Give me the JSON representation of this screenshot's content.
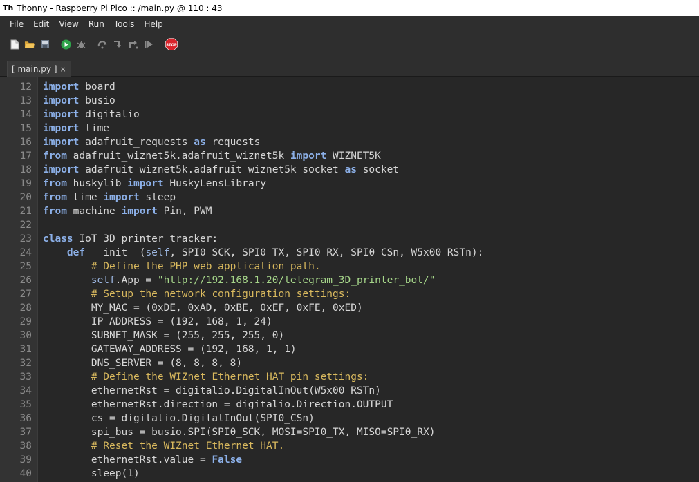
{
  "window": {
    "title": "Thonny  -  Raspberry Pi Pico :: /main.py  @  110 : 43"
  },
  "menu": [
    "File",
    "Edit",
    "View",
    "Run",
    "Tools",
    "Help"
  ],
  "toolbar": {
    "icons": [
      "new-file-icon",
      "open-file-icon",
      "save-icon",
      "run-icon",
      "debug-icon",
      "step-over-icon",
      "step-into-icon",
      "step-out-icon",
      "resume-icon",
      "stop-icon"
    ],
    "stop_label": "STOP"
  },
  "tabs": [
    {
      "label": "[ main.py ]",
      "close": "×"
    }
  ],
  "colors": {
    "keyword": "#8cb0e8",
    "comment": "#d9b95e",
    "string": "#a6d68a",
    "text": "#d6d6d6",
    "line_number": "#8a8a8a",
    "editor_bg": "#272727"
  },
  "editor": {
    "lines": [
      {
        "n": "12",
        "tokens": [
          {
            "t": "kw",
            "v": "import"
          },
          {
            "t": "plain",
            "v": " board"
          }
        ]
      },
      {
        "n": "13",
        "tokens": [
          {
            "t": "kw",
            "v": "import"
          },
          {
            "t": "plain",
            "v": " busio"
          }
        ]
      },
      {
        "n": "14",
        "tokens": [
          {
            "t": "kw",
            "v": "import"
          },
          {
            "t": "plain",
            "v": " digitalio"
          }
        ]
      },
      {
        "n": "15",
        "tokens": [
          {
            "t": "kw",
            "v": "import"
          },
          {
            "t": "plain",
            "v": " time"
          }
        ]
      },
      {
        "n": "16",
        "tokens": [
          {
            "t": "kw",
            "v": "import"
          },
          {
            "t": "plain",
            "v": " adafruit_requests "
          },
          {
            "t": "kw",
            "v": "as"
          },
          {
            "t": "plain",
            "v": " requests"
          }
        ]
      },
      {
        "n": "17",
        "tokens": [
          {
            "t": "kw",
            "v": "from"
          },
          {
            "t": "plain",
            "v": " adafruit_wiznet5k.adafruit_wiznet5k "
          },
          {
            "t": "kw",
            "v": "import"
          },
          {
            "t": "plain",
            "v": " WIZNET5K"
          }
        ]
      },
      {
        "n": "18",
        "tokens": [
          {
            "t": "kw",
            "v": "import"
          },
          {
            "t": "plain",
            "v": " adafruit_wiznet5k.adafruit_wiznet5k_socket "
          },
          {
            "t": "kw",
            "v": "as"
          },
          {
            "t": "plain",
            "v": " socket"
          }
        ]
      },
      {
        "n": "19",
        "tokens": [
          {
            "t": "kw",
            "v": "from"
          },
          {
            "t": "plain",
            "v": " huskylib "
          },
          {
            "t": "kw",
            "v": "import"
          },
          {
            "t": "plain",
            "v": " HuskyLensLibrary"
          }
        ]
      },
      {
        "n": "20",
        "tokens": [
          {
            "t": "kw",
            "v": "from"
          },
          {
            "t": "plain",
            "v": " time "
          },
          {
            "t": "kw",
            "v": "import"
          },
          {
            "t": "plain",
            "v": " sleep"
          }
        ]
      },
      {
        "n": "21",
        "tokens": [
          {
            "t": "kw",
            "v": "from"
          },
          {
            "t": "plain",
            "v": " machine "
          },
          {
            "t": "kw",
            "v": "import"
          },
          {
            "t": "plain",
            "v": " Pin, PWM"
          }
        ]
      },
      {
        "n": "22",
        "tokens": []
      },
      {
        "n": "23",
        "tokens": [
          {
            "t": "kw",
            "v": "class"
          },
          {
            "t": "plain",
            "v": " IoT_3D_printer_tracker:"
          }
        ]
      },
      {
        "n": "24",
        "tokens": [
          {
            "t": "plain",
            "v": "    "
          },
          {
            "t": "kw",
            "v": "def"
          },
          {
            "t": "plain",
            "v": " __init__("
          },
          {
            "t": "self",
            "v": "self"
          },
          {
            "t": "plain",
            "v": ", SPI0_SCK, SPI0_TX, SPI0_RX, SPI0_CSn, W5x00_RSTn):"
          }
        ]
      },
      {
        "n": "25",
        "tokens": [
          {
            "t": "plain",
            "v": "        "
          },
          {
            "t": "cmt",
            "v": "# Define the PHP web application path."
          }
        ]
      },
      {
        "n": "26",
        "tokens": [
          {
            "t": "plain",
            "v": "        "
          },
          {
            "t": "self",
            "v": "self"
          },
          {
            "t": "plain",
            "v": ".App = "
          },
          {
            "t": "str",
            "v": "\"http://192.168.1.20/telegram_3D_printer_bot/\""
          }
        ]
      },
      {
        "n": "27",
        "tokens": [
          {
            "t": "plain",
            "v": "        "
          },
          {
            "t": "cmt",
            "v": "# Setup the network configuration settings:"
          }
        ]
      },
      {
        "n": "28",
        "tokens": [
          {
            "t": "plain",
            "v": "        MY_MAC = (0xDE, 0xAD, 0xBE, 0xEF, 0xFE, 0xED)"
          }
        ]
      },
      {
        "n": "29",
        "tokens": [
          {
            "t": "plain",
            "v": "        IP_ADDRESS = (192, 168, 1, 24)"
          }
        ]
      },
      {
        "n": "30",
        "tokens": [
          {
            "t": "plain",
            "v": "        SUBNET_MASK = (255, 255, 255, 0)"
          }
        ]
      },
      {
        "n": "31",
        "tokens": [
          {
            "t": "plain",
            "v": "        GATEWAY_ADDRESS = (192, 168, 1, 1)"
          }
        ]
      },
      {
        "n": "32",
        "tokens": [
          {
            "t": "plain",
            "v": "        DNS_SERVER = (8, 8, 8, 8)"
          }
        ]
      },
      {
        "n": "33",
        "tokens": [
          {
            "t": "plain",
            "v": "        "
          },
          {
            "t": "cmt",
            "v": "# Define the WIZnet Ethernet HAT pin settings:"
          }
        ]
      },
      {
        "n": "34",
        "tokens": [
          {
            "t": "plain",
            "v": "        ethernetRst = digitalio.DigitalInOut(W5x00_RSTn)"
          }
        ]
      },
      {
        "n": "35",
        "tokens": [
          {
            "t": "plain",
            "v": "        ethernetRst.direction = digitalio.Direction.OUTPUT"
          }
        ]
      },
      {
        "n": "36",
        "tokens": [
          {
            "t": "plain",
            "v": "        cs = digitalio.DigitalInOut(SPI0_CSn)"
          }
        ]
      },
      {
        "n": "37",
        "tokens": [
          {
            "t": "plain",
            "v": "        spi_bus = busio.SPI(SPI0_SCK, MOSI=SPI0_TX, MISO=SPI0_RX)"
          }
        ]
      },
      {
        "n": "38",
        "tokens": [
          {
            "t": "plain",
            "v": "        "
          },
          {
            "t": "cmt",
            "v": "# Reset the WIZnet Ethernet HAT."
          }
        ]
      },
      {
        "n": "39",
        "tokens": [
          {
            "t": "plain",
            "v": "        ethernetRst.value = "
          },
          {
            "t": "kw",
            "v": "False"
          }
        ]
      },
      {
        "n": "40",
        "tokens": [
          {
            "t": "plain",
            "v": "        sleep(1)"
          }
        ]
      }
    ]
  }
}
